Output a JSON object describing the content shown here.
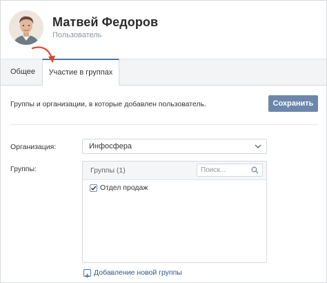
{
  "profile": {
    "name": "Матвей Федоров",
    "role": "Пользователь"
  },
  "tabs": [
    {
      "label": "Общее",
      "active": false
    },
    {
      "label": "Участие в группах",
      "active": true
    }
  ],
  "content": {
    "description": "Группы и организации, в которые добавлен пользователь.",
    "save_label": "Сохранить",
    "organization": {
      "label": "Организация:",
      "value": "Инфосфера"
    },
    "groups": {
      "label": "Группы:",
      "header": "Группы (1)",
      "search_placeholder": "Поиск...",
      "items": [
        {
          "name": "Отдел продаж",
          "checked": true
        }
      ]
    },
    "add_group_label": "Добавление новой группы"
  },
  "colors": {
    "accent": "#4a76a8",
    "button": "#6c87ab",
    "link": "#2a5885",
    "annotation_arrow": "#d9472b"
  },
  "icons": [
    "avatar-photo",
    "chevron-down-icon",
    "search-icon",
    "checkmark-icon",
    "plus-icon",
    "annotation-arrow"
  ]
}
